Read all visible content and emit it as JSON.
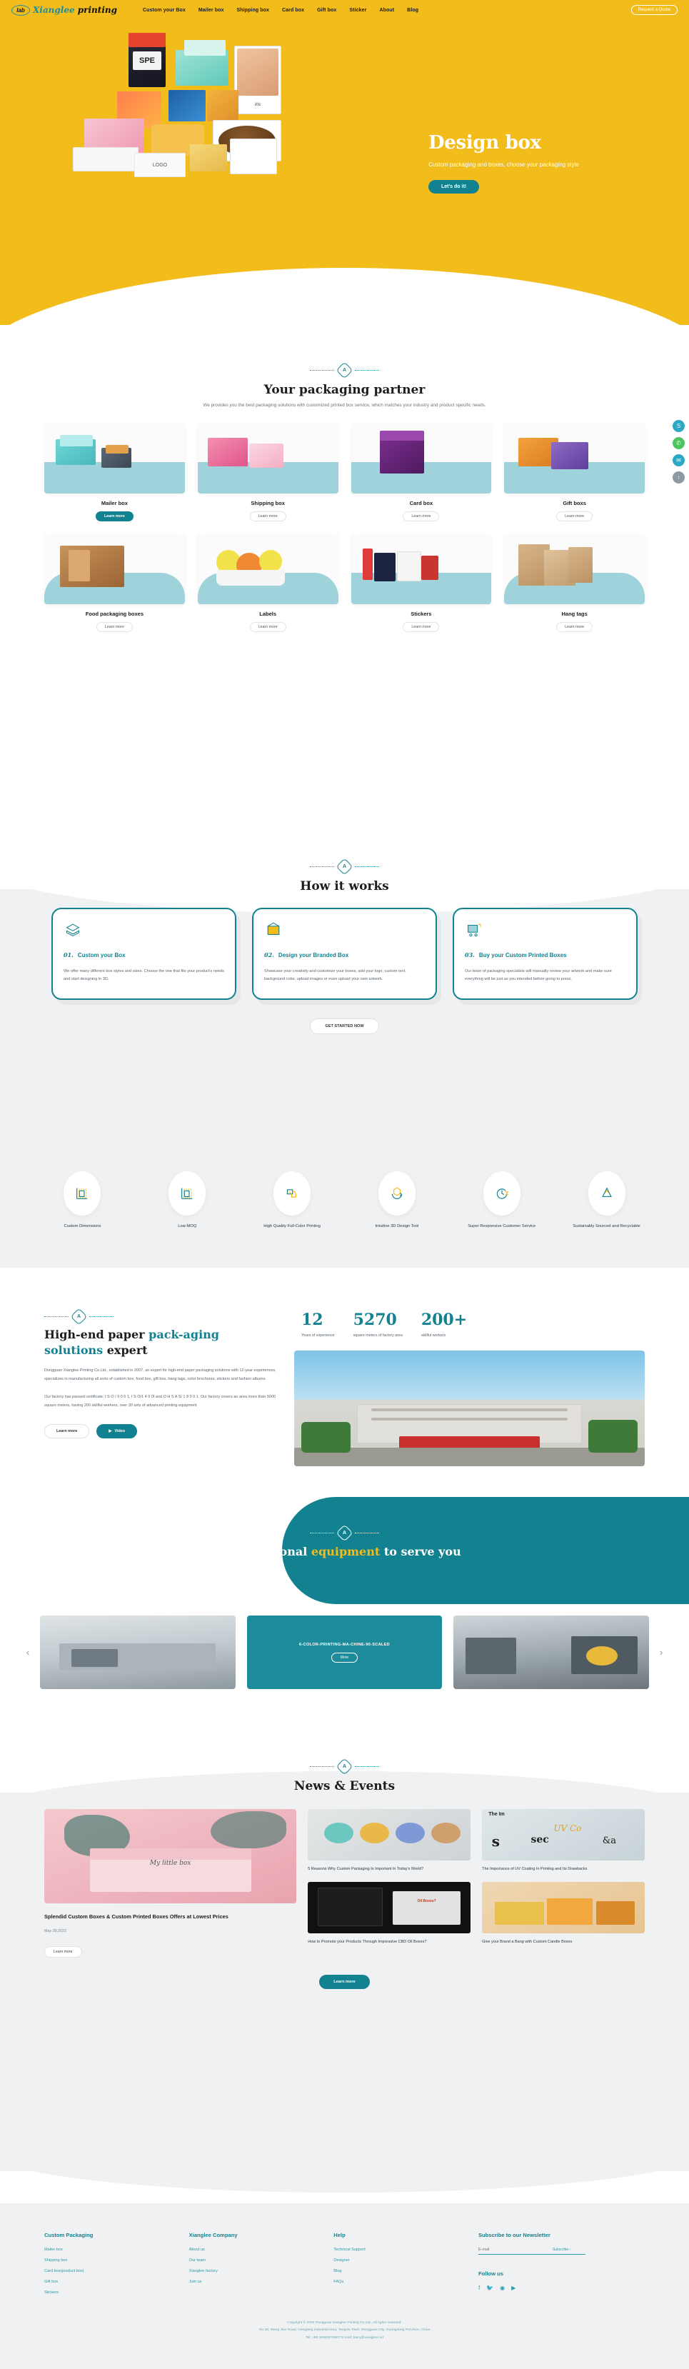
{
  "brand": {
    "logo_mark": "lab",
    "name_part1": "Xianglee",
    "name_part2": "printing"
  },
  "nav": {
    "items": [
      {
        "label": "Custom your Box"
      },
      {
        "label": "Mailer box"
      },
      {
        "label": "Shipping box"
      },
      {
        "label": "Card box"
      },
      {
        "label": "Gift box"
      },
      {
        "label": "Sticker"
      },
      {
        "label": "About"
      },
      {
        "label": "Blog"
      }
    ],
    "quote_button": "Request a Quote"
  },
  "hero": {
    "title": "Design box",
    "subtitle": "Custom packaging and boxes, choose your packaging style",
    "cta": "Let's do it!",
    "bg_color": "#F2BC1B"
  },
  "side_icons": [
    {
      "name": "skype-icon",
      "glyph": "S",
      "color": "#2aa8c4"
    },
    {
      "name": "whatsapp-icon",
      "glyph": "✆",
      "color": "#4ec45e"
    },
    {
      "name": "email-icon",
      "glyph": "✉",
      "color": "#2aa8c4"
    },
    {
      "name": "scroll-top-icon",
      "glyph": "↑",
      "color": "#8e9aa3"
    }
  ],
  "products": {
    "title": "Your packaging partner",
    "description": "We provides you the best packaging solutions with customized printed box service, which matches your industry and product specific needs.",
    "items": [
      {
        "label": "Mailer box",
        "cta": "Learn more",
        "cta_style": "solid"
      },
      {
        "label": "Shipping box",
        "cta": "Learn more",
        "cta_style": "outline"
      },
      {
        "label": "Card box",
        "cta": "Learn more",
        "cta_style": "outline"
      },
      {
        "label": "Gift boxs",
        "cta": "Learn more",
        "cta_style": "outline"
      },
      {
        "label": "Food packaging boxes",
        "cta": "Learn more",
        "cta_style": "outline"
      },
      {
        "label": "Labels",
        "cta": "Learn more",
        "cta_style": "outline"
      },
      {
        "label": "Stickers",
        "cta": "Learn more",
        "cta_style": "outline"
      },
      {
        "label": "Hang tags",
        "cta": "Learn more",
        "cta_style": "outline"
      }
    ]
  },
  "how": {
    "title": "How it works",
    "cta": "GET STARTED NOW",
    "steps": [
      {
        "number": "01.",
        "heading": "Custom your Box",
        "body": "We offer many different box styles and sizes. Choose the one that fits your product's needs and start designing in 3D.",
        "icon": "layers-box-icon"
      },
      {
        "number": "02.",
        "heading": "Design your Branded Box",
        "body": "Showcase your creativity and customize your boxes, add your logo, custom text, background color, upload images or even upload your own artwork.",
        "icon": "design-box-icon"
      },
      {
        "number": "03.",
        "heading": "Buy your Custom Printed Boxes",
        "body": "Our team of packaging specialists will manually review your artwork and make sure everything will be just as you intended before going to press.",
        "icon": "cart-box-icon"
      }
    ]
  },
  "features": [
    {
      "label": "Custom Dimensions",
      "icon": "dimensions-icon"
    },
    {
      "label": "Low MOQ",
      "icon": "moq-icon"
    },
    {
      "label": "High Quality Full-Color Printing",
      "icon": "printing-roll-icon"
    },
    {
      "label": "Intuitive 3D Design Tool",
      "icon": "cube-3d-icon"
    },
    {
      "label": "Super Responsive Customer Service",
      "icon": "fast-clock-icon"
    },
    {
      "label": "Sustainably Sourced and Recyclable",
      "icon": "recycle-icon"
    }
  ],
  "about": {
    "title_plain1": "High-end paper ",
    "title_hl": "pack-aging solutions",
    "title_plain2": " expert",
    "paragraph1": "Dongguan Xianglee Printing Co.Ltd., established in 2007, an expert for high-end paper packaging solutions with 12-year experiences, specializes in manufacturing all sorts of custom box, food box, gift box, hang tags, color brochures, stickers and fashion albums.",
    "paragraph2": "Our factory has passed certificate: I S O / 9 0 0 1, I S O/1 4 0 0I and O H S A S/ 1 8 0 0 1. Our factory covers an area more than 5000 square meters, having 200 skillful workers, over 30 sets of advanced printing equipment",
    "btn_learn": "Learn more",
    "btn_video": "Video",
    "stats": [
      {
        "number": "12",
        "label": "Years of experience"
      },
      {
        "number": "5270",
        "label": "square meters of factory area"
      },
      {
        "number": "200+",
        "label": "skillful workers"
      }
    ]
  },
  "equipment": {
    "title_plain1": "Professional ",
    "title_hl": "equipment",
    "title_plain2": " to serve you",
    "slide_caption": "6-COLOR-PRINTING-MA-CHINE-90-SCALED",
    "more_label": "More",
    "prev": "‹",
    "next": "›"
  },
  "news": {
    "title": "News & Events",
    "cta": "Learn more",
    "featured": {
      "title": "Splendid Custom Boxes & Custom Printed Boxes Offers at Lowest Prices",
      "date": "May 30,2022",
      "pill": "Learn more",
      "image_caption": "My little box"
    },
    "items": [
      {
        "title": "5 Reasons Why Custom Packaging Is Important In Today's World?"
      },
      {
        "title": "The Importance of UV Coating In Printing and Its Drawbacks"
      },
      {
        "title": "How to Promote your Products Through Impressive CBD Oil Boxes?"
      },
      {
        "title": "Give your Brand a Bang with Custom Candle Boxes"
      }
    ]
  },
  "footer": {
    "columns": [
      {
        "heading": "Custom Packaging",
        "links": [
          "Mailer box",
          "Shipping box",
          "Card box(product box)",
          "Gift box",
          "Stickers"
        ]
      },
      {
        "heading": "Xianglee Company",
        "links": [
          "About us",
          "Our team",
          "Xianglee factory",
          "Join us"
        ]
      },
      {
        "heading": "Help",
        "links": [
          "Technical Support",
          "Designer",
          "Blog",
          "FAQs"
        ]
      }
    ],
    "newsletter": {
      "heading": "Subscribe to our Newsletter",
      "placeholder": "E-mail",
      "submit": "Subscribe ›"
    },
    "follow_heading": "Follow us",
    "socials": [
      {
        "name": "facebook-icon",
        "glyph": "f"
      },
      {
        "name": "twitter-icon",
        "glyph": "🐦"
      },
      {
        "name": "instagram-icon",
        "glyph": "◉"
      },
      {
        "name": "youtube-icon",
        "glyph": "▶"
      }
    ],
    "copyright_line1": "Copyright © 2022 Dongguan Xianglee Printing Co.Ltd., All rights reserved.",
    "copyright_line2": "No.28, Wang Jiao Road, Hengtang Industrial Area, Tangxia Town, Dongguan City, Guangdong Province, China",
    "copyright_line3": "Tel: +86 15362872607        E-mail: barry@xianglee.net"
  }
}
